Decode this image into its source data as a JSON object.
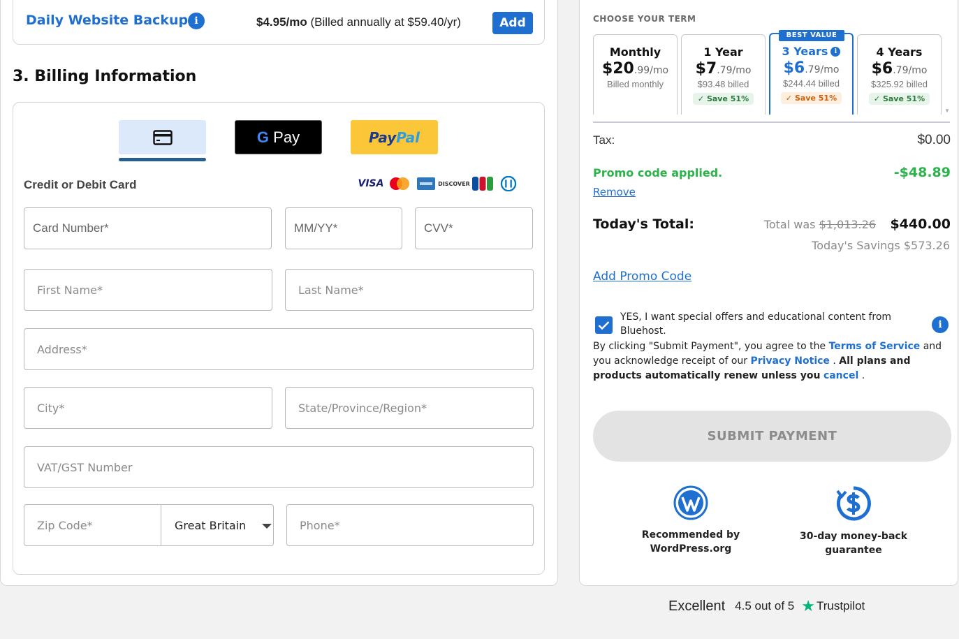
{
  "backup": {
    "title": "Daily Website Backup",
    "price": "$4.95/mo",
    "billing_note": "(Billed annually at $59.40/yr)",
    "add_label": "Add"
  },
  "billing": {
    "section_title": "3. Billing Information",
    "payment_methods": {
      "card_icon": "credit-card-icon",
      "gpay_g": "G",
      "gpay_label": "Pay",
      "paypal_part1": "Pay",
      "paypal_part2": "Pal"
    },
    "card_label": "Credit or Debit Card",
    "brands": [
      "VISA",
      "Mastercard",
      "American Express",
      "DISCOVER",
      "JCB",
      "Diners Club"
    ],
    "fields": {
      "card_number": "Card Number*",
      "expiry": "MM/YY*",
      "cvv": "CVV*",
      "first_name": "First Name*",
      "last_name": "Last Name*",
      "address": "Address*",
      "city": "City*",
      "state": "State/Province/Region*",
      "vat": "VAT/GST Number",
      "zip": "Zip Code*",
      "country": "Great Britain",
      "phone": "Phone*"
    }
  },
  "term": {
    "heading": "CHOOSE YOUR TERM",
    "options": [
      {
        "name": "Monthly",
        "dollars": "$20",
        "cents": ".99",
        "per": "/mo",
        "billed": "Billed monthly",
        "save": "",
        "selected": false
      },
      {
        "name": "1 Year",
        "dollars": "$7",
        "cents": ".79",
        "per": "/mo",
        "billed": "$93.48 billed",
        "save": "Save 51%",
        "selected": false
      },
      {
        "name": "3 Years",
        "dollars": "$6",
        "cents": ".79",
        "per": "/mo",
        "billed": "$244.44 billed",
        "save": "Save 51%",
        "selected": true,
        "badge": "BEST VALUE"
      },
      {
        "name": "4 Years",
        "dollars": "$6",
        "cents": ".79",
        "per": "/mo",
        "billed": "$325.92 billed",
        "save": "Save 51%",
        "selected": false
      }
    ]
  },
  "summary": {
    "tax_label": "Tax:",
    "tax_value": "$0.00",
    "promo_label": "Promo code applied.",
    "promo_value": "-$48.89",
    "remove_label": "Remove",
    "total_label": "Today's Total:",
    "total_was_prefix": "Total was",
    "total_was_value": "$1,013.26",
    "total_value": "$440.00",
    "savings": "Today's Savings $573.26",
    "add_promo": "Add Promo Code"
  },
  "consent": {
    "optin_checked": true,
    "optin_text": "YES, I want special offers and educational content from Bluehost.",
    "legal_1": "By clicking \"Submit Payment\", you agree to the ",
    "terms_link": "Terms of Service",
    "legal_2": " and you acknowledge receipt of our ",
    "privacy_link": "Privacy Notice",
    "legal_3": " . ",
    "legal_bold": "All plans and products automatically renew unless you",
    "cancel_link": "cancel",
    "legal_4": " ."
  },
  "submit_label": "SUBMIT PAYMENT",
  "trust": {
    "wp_text_1": "Recommended by",
    "wp_text_2": "WordPress.org",
    "money_text_1": "30-day money-back",
    "money_text_2": "guarantee"
  },
  "trustpilot": {
    "excellent": "Excellent",
    "rating": "4.5 out of 5",
    "brand": "Trustpilot"
  },
  "colors": {
    "accent": "#1f6fd1",
    "promo_green": "#2cb44a",
    "badge_bg": "#1f6fd1"
  }
}
